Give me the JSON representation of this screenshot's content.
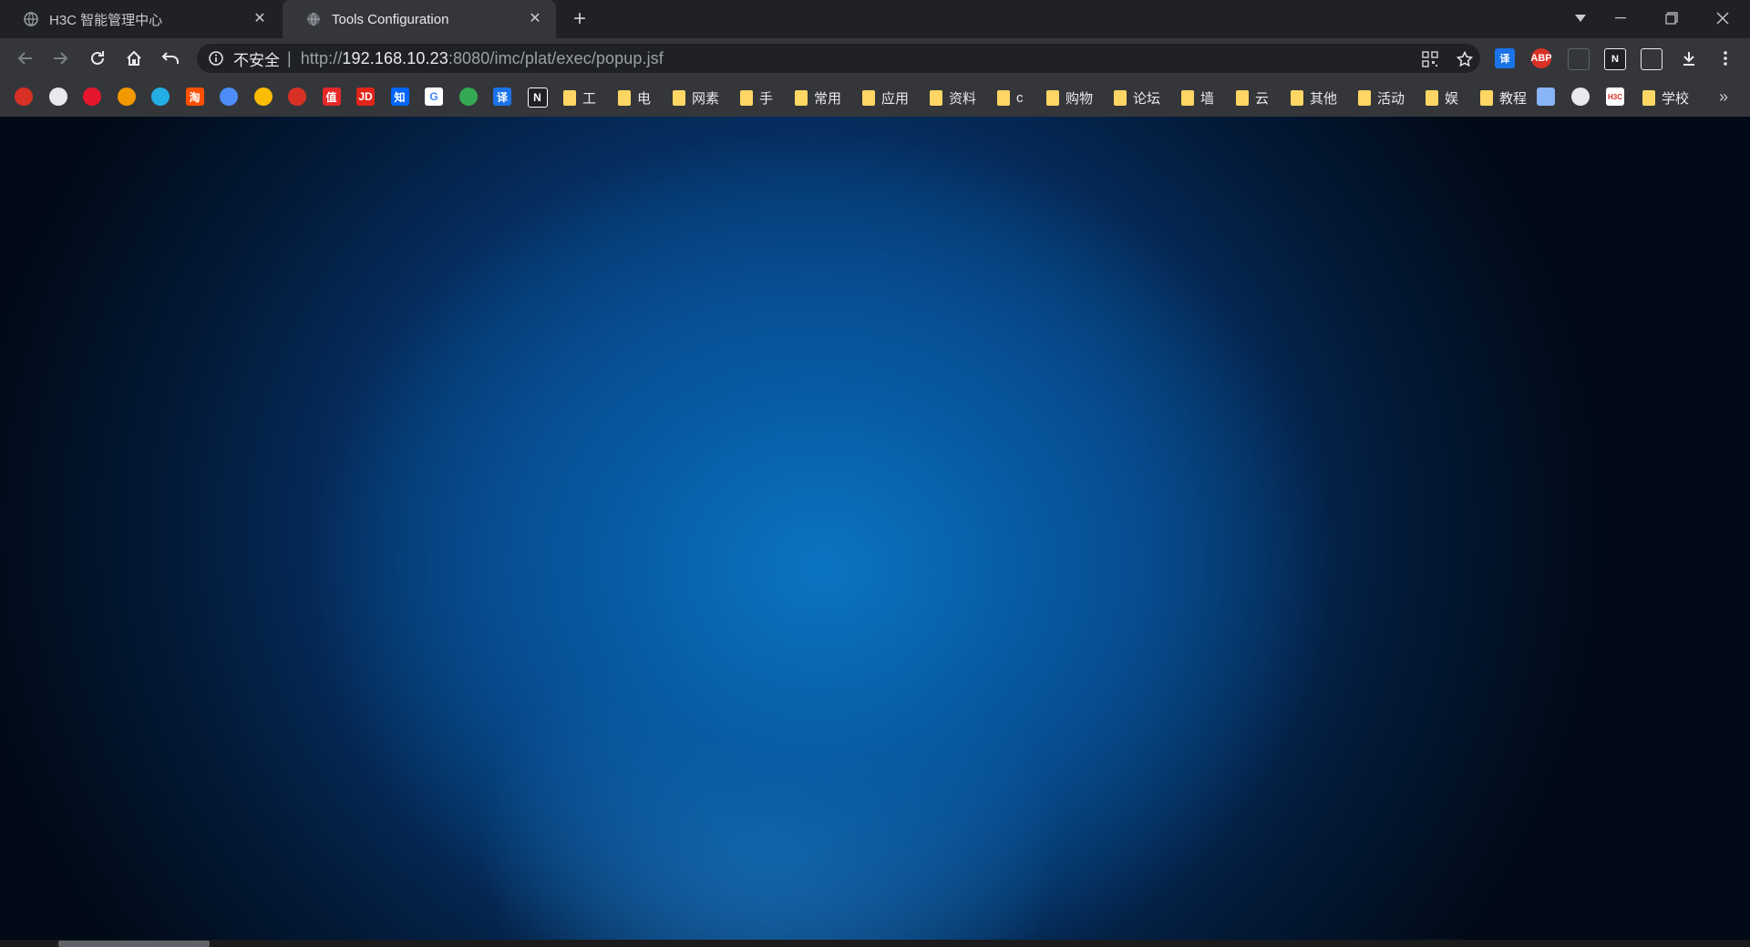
{
  "tabs": [
    {
      "title": "H3C 智能管理中心",
      "active": false
    },
    {
      "title": "Tools Configuration",
      "active": true
    }
  ],
  "address_bar": {
    "security_label": "不安全",
    "url_scheme": "http://",
    "url_host": "192.168.10.23",
    "url_rest": ":8080/imc/plat/exec/popup.jsf"
  },
  "extensions": [
    {
      "name": "translate-extension-icon",
      "text": "译",
      "color": "#1a73e8"
    },
    {
      "name": "adblock-plus-icon",
      "text": "ABP",
      "color": "#d93025"
    },
    {
      "name": "glasses-extension-icon",
      "text": "",
      "color": "#5f6368"
    },
    {
      "name": "notion-extension-icon",
      "text": "N",
      "color": "#ffffff"
    },
    {
      "name": "grid-extension-icon",
      "text": "",
      "color": "#e8eaed"
    }
  ],
  "bookmark_icons": [
    {
      "name": "red-app-icon",
      "text": "",
      "color": "#d93025"
    },
    {
      "name": "globe-icon",
      "text": "",
      "color": "#e8eaed"
    },
    {
      "name": "weibo-icon",
      "text": "",
      "color": "#e6162d"
    },
    {
      "name": "mascot-icon",
      "text": "",
      "color": "#f29900"
    },
    {
      "name": "bilibili-icon",
      "text": "",
      "color": "#23ade5"
    },
    {
      "name": "taobao-icon",
      "text": "淘",
      "color": "#ff5000"
    },
    {
      "name": "baidu-netdisk-icon",
      "text": "",
      "color": "#4e8cf7"
    },
    {
      "name": "colorful-app-icon",
      "text": "",
      "color": "#fbbc04"
    },
    {
      "name": "calendar-app-icon",
      "text": "",
      "color": "#d93025"
    },
    {
      "name": "smzdm-icon",
      "text": "值",
      "color": "#e62828"
    },
    {
      "name": "jd-icon",
      "text": "JD",
      "color": "#e1251b"
    },
    {
      "name": "zhihu-icon",
      "text": "知",
      "color": "#0066ff"
    },
    {
      "name": "google-icon",
      "text": "G",
      "color": "#4285f4"
    },
    {
      "name": "chrome-icon",
      "text": "",
      "color": "#34a853"
    },
    {
      "name": "translate-icon",
      "text": "译",
      "color": "#1a73e8"
    },
    {
      "name": "notion-icon",
      "text": "N",
      "color": "#ffffff"
    }
  ],
  "bookmark_folders": [
    "工",
    "电",
    "网素",
    "手",
    "常用",
    "应用",
    "资料",
    "c",
    "购物",
    "论坛",
    "墙",
    "云",
    "其他",
    "活动",
    "娱",
    "教程"
  ],
  "bookmark_icons_tail": [
    {
      "name": "router-icon",
      "text": "",
      "color": "#8ab4f8"
    },
    {
      "name": "globe-icon-2",
      "text": "",
      "color": "#e8eaed"
    },
    {
      "name": "h3c-icon",
      "text": "H3C",
      "color": "#d93025"
    }
  ],
  "bookmark_last_folder": "学校",
  "colors": {
    "accent": "#0a74c2",
    "chrome_dark": "#202124",
    "chrome_toolbar": "#35363a"
  }
}
